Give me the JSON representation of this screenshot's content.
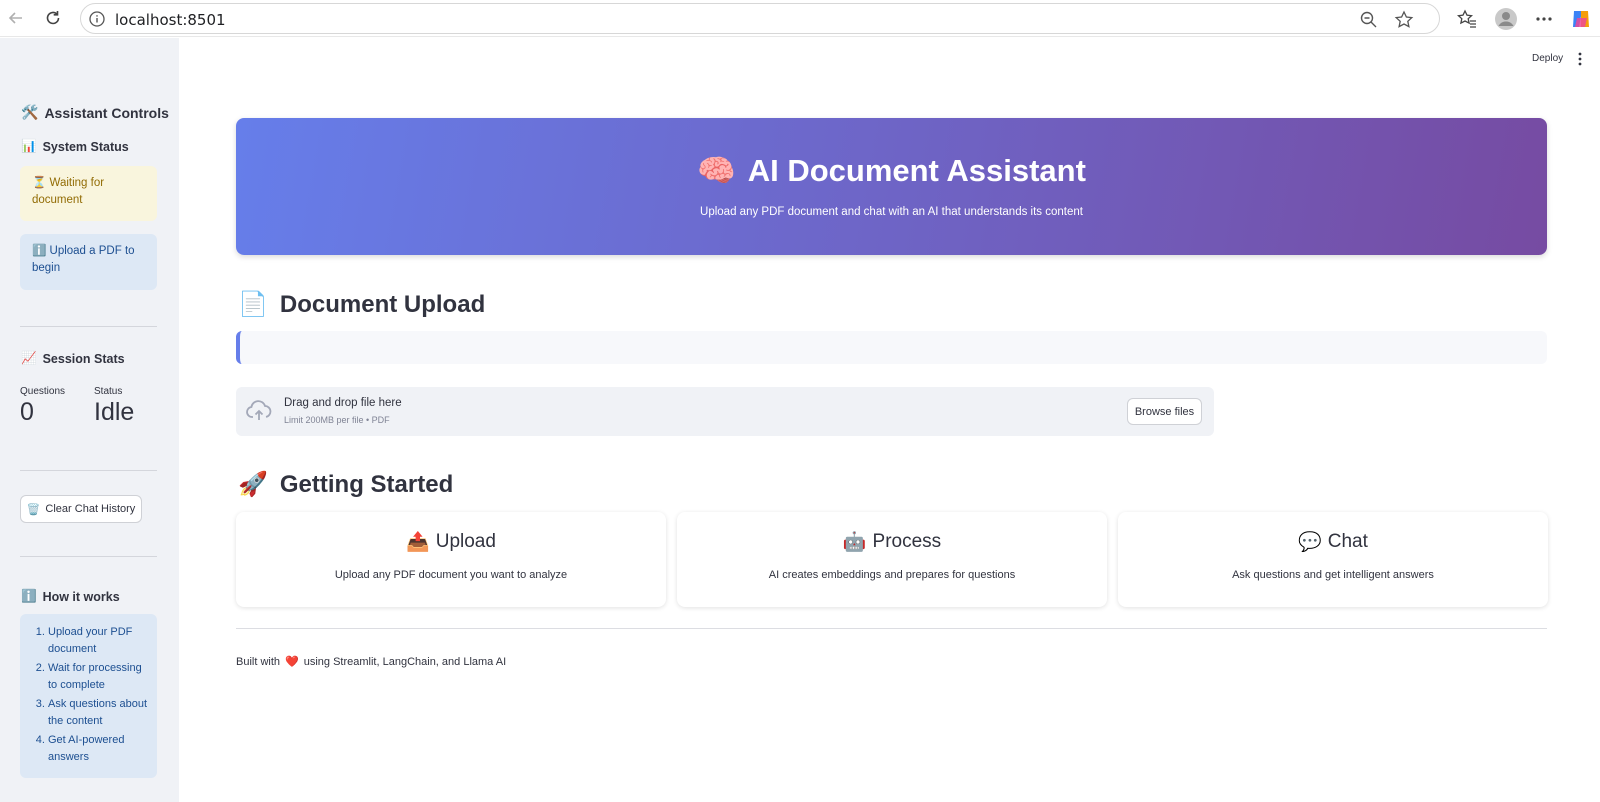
{
  "browser": {
    "url": "localhost:8501"
  },
  "toolbar": {
    "deploy_label": "Deploy"
  },
  "sidebar": {
    "title": "Assistant Controls",
    "title_icon": "🛠️",
    "system_status": {
      "title": "System Status",
      "icon": "📊",
      "warning": "⏳ Waiting for document",
      "info": "ℹ️ Upload a PDF to begin"
    },
    "session_stats": {
      "title": "Session Stats",
      "icon": "📈",
      "questions_label": "Questions",
      "questions_value": "0",
      "status_label": "Status",
      "status_value": "Idle"
    },
    "clear_button": "Clear Chat History",
    "clear_icon": "🗑️",
    "how_it_works": {
      "title": "How it works",
      "icon": "ℹ️",
      "steps": [
        "Upload your PDF document",
        "Wait for processing to complete",
        "Ask questions about the content",
        "Get AI-powered answers"
      ]
    }
  },
  "hero": {
    "icon": "🧠",
    "title": "AI Document Assistant",
    "subtitle": "Upload any PDF document and chat with an AI that understands its content",
    "gradient": [
      "#667eea",
      "#764ba2"
    ]
  },
  "document_upload": {
    "icon": "📄",
    "title": "Document Upload",
    "dropzone_text": "Drag and drop file here",
    "dropzone_limit": "Limit 200MB per file • PDF",
    "browse_button": "Browse files"
  },
  "getting_started": {
    "icon": "🚀",
    "title": "Getting Started",
    "cards": [
      {
        "icon": "📤",
        "title": "Upload",
        "description": "Upload any PDF document you want to analyze"
      },
      {
        "icon": "🤖",
        "title": "Process",
        "description": "AI creates embeddings and prepares for questions"
      },
      {
        "icon": "💬",
        "title": "Chat",
        "description": "Ask questions and get intelligent answers"
      }
    ]
  },
  "footer": {
    "prefix": "Built with",
    "heart": "❤️",
    "suffix": "using Streamlit, LangChain, and Llama AI"
  }
}
